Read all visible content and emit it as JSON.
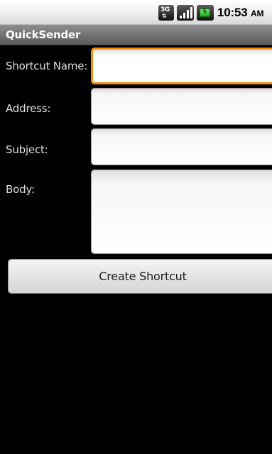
{
  "status_bar": {
    "network_badge": "3G",
    "network_icon": "3g-data-icon",
    "signal_icon": "signal-strength-icon",
    "battery_icon": "battery-charging-icon",
    "time": "10:53",
    "ampm": "AM",
    "battery_color": "#2ec42e"
  },
  "app": {
    "title": "QuickSender"
  },
  "form": {
    "shortcut_name": {
      "label": "Shortcut Name:",
      "value": ""
    },
    "address": {
      "label": "Address:",
      "value": ""
    },
    "subject": {
      "label": "Subject:",
      "value": ""
    },
    "body": {
      "label": "Body:",
      "value": ""
    }
  },
  "actions": {
    "create_shortcut_label": "Create Shortcut"
  },
  "colors": {
    "focus_border": "#f7890c",
    "background": "#000000",
    "label_text": "#dedede"
  }
}
